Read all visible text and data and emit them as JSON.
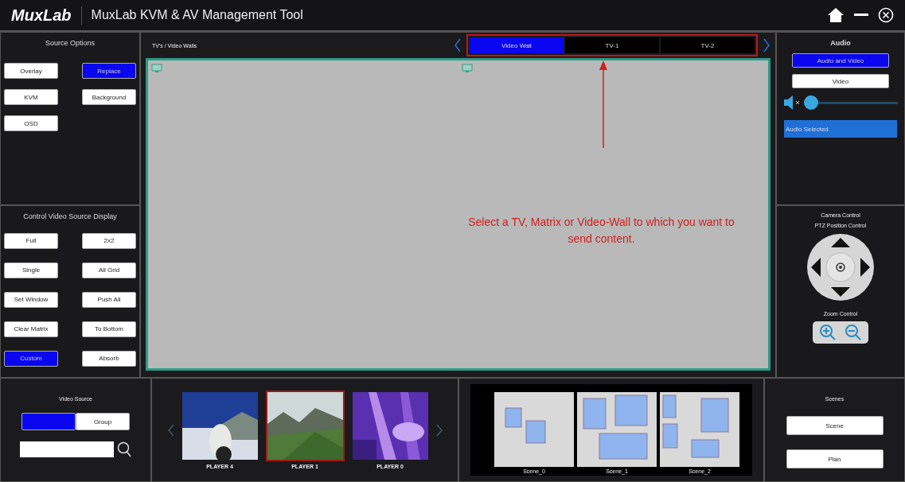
{
  "header": {
    "logo": "MuxLab",
    "title": "MuxLab KVM & AV Management Tool"
  },
  "source_options": {
    "title": "Source Options",
    "buttons": [
      {
        "label": "Overlay",
        "selected": false
      },
      {
        "label": "Replace",
        "selected": true
      },
      {
        "label": "KVM",
        "selected": false
      },
      {
        "label": "Background",
        "selected": false
      },
      {
        "label": "OSD",
        "selected": false
      }
    ]
  },
  "display_control": {
    "title": "Control Video Source Display",
    "buttons": [
      {
        "label": "Full",
        "selected": false
      },
      {
        "label": "2x2",
        "selected": false
      },
      {
        "label": "Single",
        "selected": false
      },
      {
        "label": "All Grid",
        "selected": false
      },
      {
        "label": "Set Window",
        "selected": false
      },
      {
        "label": "Push All",
        "selected": false
      },
      {
        "label": "Clear Matrix",
        "selected": false
      },
      {
        "label": "To Bottom",
        "selected": false
      },
      {
        "label": "Custom",
        "selected": true
      },
      {
        "label": "Absorb",
        "selected": false
      }
    ]
  },
  "displays": {
    "title": "TV's / Video Walls",
    "tabs": [
      {
        "label": "Video Wall",
        "selected": true
      },
      {
        "label": "TV-1",
        "selected": false
      },
      {
        "label": "TV-2",
        "selected": false
      }
    ],
    "annotation": "Select a TV, Matrix or Video-Wall to which you want to send content."
  },
  "audio": {
    "title": "Audio",
    "modes": [
      {
        "label": "Audio and Video",
        "selected": true
      },
      {
        "label": "Video",
        "selected": false
      }
    ],
    "muted": true,
    "volume": {
      "level": 0.06
    },
    "status": "Audio Selected"
  },
  "camera": {
    "title": "Camera Control",
    "ptz_label": "PTZ Position Control",
    "zoom_label": "Zoom Control"
  },
  "video_source": {
    "title": "Video Source",
    "modes": [
      {
        "selected": true
      },
      {
        "label": "Group",
        "selected": false
      }
    ]
  },
  "players": [
    {
      "label": "PLAYER 4",
      "selected": false
    },
    {
      "label": "PLAYER 1",
      "selected": true
    },
    {
      "label": "PLAYER 0",
      "selected": false
    }
  ],
  "scene_thumbnails": [
    {
      "label": "Scene_0"
    },
    {
      "label": "Scene_1"
    },
    {
      "label": "Scene_2"
    }
  ],
  "scenes": {
    "title": "Scenes",
    "buttons": [
      "Scene",
      "Plan"
    ]
  }
}
